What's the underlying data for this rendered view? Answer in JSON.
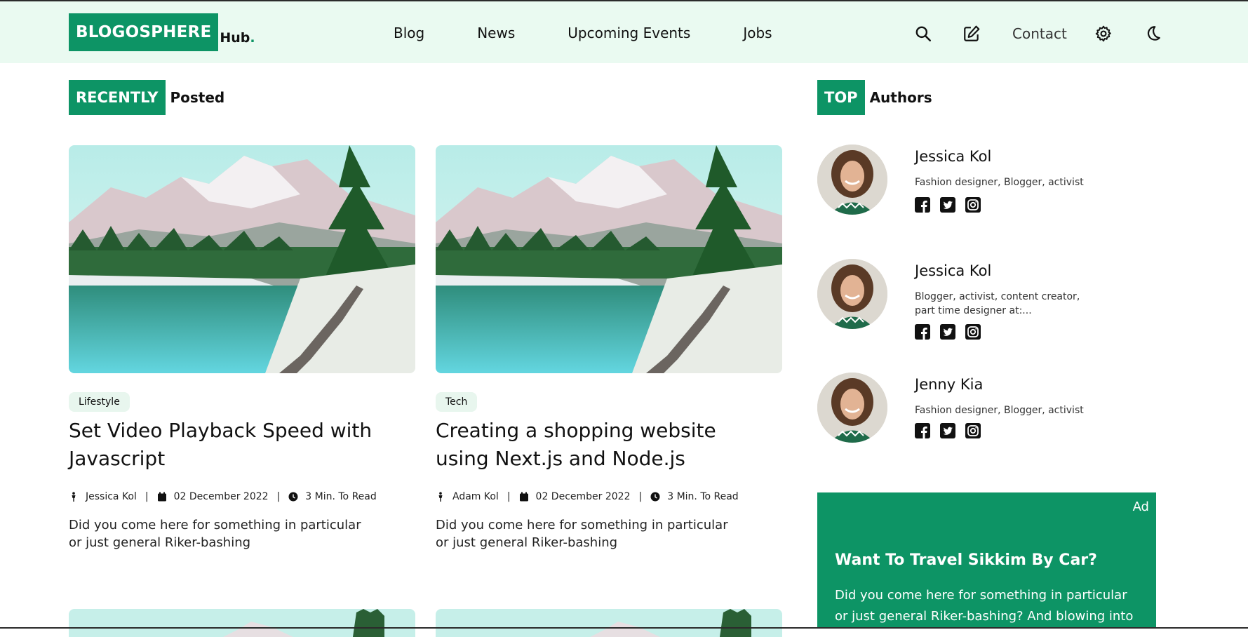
{
  "header": {
    "logo_main": "BLOGOSPHERE",
    "logo_suffix": "Hub",
    "logo_dot": ".",
    "nav": [
      "Blog",
      "News",
      "Upcoming Events",
      "Jobs"
    ],
    "contact": "Contact",
    "icons": [
      "search-icon",
      "edit-icon",
      "settings-icon",
      "moon-icon"
    ]
  },
  "recent": {
    "label_box": "RECENTLY",
    "label_rest": "Posted",
    "posts": [
      {
        "category": "Lifestyle",
        "title": "Set Video Playback Speed with Javascript",
        "author": "Jessica Kol",
        "date": "02 December 2022",
        "read_time": "3 Min. To Read",
        "excerpt": "Did you come here for something in particular or just general Riker-bashing"
      },
      {
        "category": "Tech",
        "title": "Creating a shopping website using Next.js and Node.js",
        "author": "Adam Kol",
        "date": "02 December 2022",
        "read_time": "3 Min. To Read",
        "excerpt": "Did you come here for something in particular or just general Riker-bashing"
      }
    ]
  },
  "top_authors": {
    "label_box": "TOP",
    "label_rest": "Authors",
    "authors": [
      {
        "name": "Jessica Kol",
        "desc": "Fashion designer, Blogger, activist"
      },
      {
        "name": "Jessica Kol",
        "desc": "Blogger, activist, content creator, part time designer at:..."
      },
      {
        "name": "Jenny Kia",
        "desc": "Fashion designer, Blogger, activist"
      }
    ],
    "social_icons": [
      "facebook-icon",
      "twitter-icon",
      "instagram-icon"
    ]
  },
  "ad": {
    "label": "Ad",
    "title": "Want To Travel Sikkim By Car?",
    "text": "Did you come here for something in particular or just general Riker-bashing? And blowing into"
  },
  "colors": {
    "brand": "#0d9465",
    "header_bg": "#eafaf1",
    "tag_bg": "#e8f6ee"
  }
}
